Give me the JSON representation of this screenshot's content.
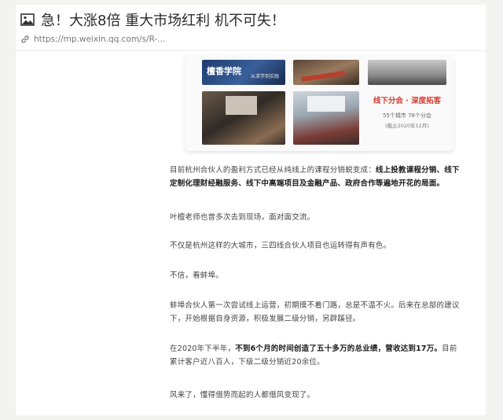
{
  "header": {
    "title": "急！大涨8倍 重大市场红利 机不可失！",
    "url": "https://mp.weixin.qq.com/s/R-..."
  },
  "collage": {
    "brand": "檀香学院",
    "brand_sub": "从求学到实践",
    "slogan": "线下分会 · 深度拓客",
    "stats": "55个城市 76个分会",
    "date": "(截止2020年12月)"
  },
  "article": {
    "p1": {
      "plain": "目前杭州合伙人的盈利方式已经从纯线上的课程分销蜕变成：",
      "bold": "线上投教课程分销、线下定制化理财经融服务、线下中高端项目及金融产品、政府合作等遍地开花的局面。"
    },
    "p2": "叶檀老师也曾多次去到现场，面对面交流。",
    "p3": "不仅是杭州这样的大城市，三四线合伙人项目也运转得有声有色。",
    "p4": "不信，看蚌埠。",
    "p5": "蚌埠合伙人第一次尝试线上运营，初期摸不着门路，总是不温不火。后来在总部的建议下，开始根据自身资源，积极发展二级分销，另辟蹊径。",
    "p6": {
      "a": "在2020年下半年，",
      "b": "不到6个月的时间创造了五十多万的总业绩，营收达到17万。",
      "c": "目前累计客户近八百人，下级二级分销近20余位。"
    },
    "p7": "风来了，懂得借势而起的人都借风变现了。"
  },
  "colors": {
    "accent_red": "#d23a2f",
    "text": "#444444",
    "background": "#f3f3f1"
  }
}
